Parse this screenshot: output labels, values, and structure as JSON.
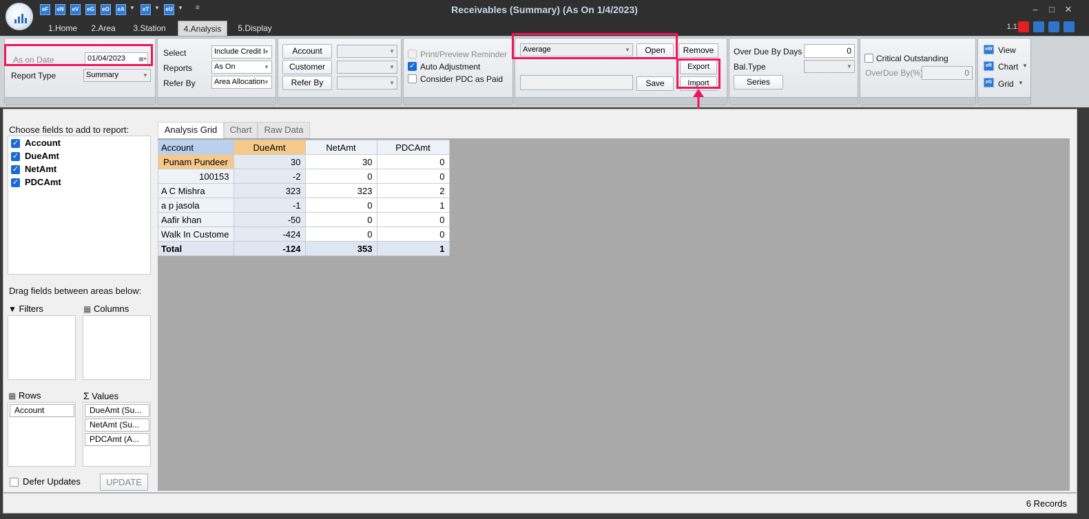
{
  "window": {
    "title": "Receivables (Summary) (As On 1/4/2023)",
    "version": "1.12",
    "quick_access": [
      "eF",
      "eN",
      "eV",
      "eG",
      "eO",
      "eA",
      "eT",
      "eU"
    ],
    "ribbon_tabs": [
      "1.Home",
      "2.Area",
      "3.Station",
      "4.Analysis",
      "5.Display"
    ],
    "active_tab": "4.Analysis"
  },
  "ribbon": {
    "date_group": {
      "as_on_date_label": "As on Date",
      "as_on_date_value": "01/04/2023",
      "report_type_label": "Report Type",
      "report_type_value": "Summary"
    },
    "select_group": {
      "select_label": "Select",
      "select_value": "Include Credit I",
      "reports_label": "Reports",
      "reports_value": "As On",
      "refer_by_label": "Refer By",
      "refer_by_value": "Area Allocation"
    },
    "filter_group": {
      "account_button": "Account",
      "customer_button": "Customer",
      "refer_by_button": "Refer By"
    },
    "options_group": {
      "print_preview_reminder": "Print/Preview Reminder",
      "auto_adjustment": "Auto Adjustment",
      "consider_pdc_as_paid": "Consider PDC as Paid"
    },
    "layout_group": {
      "layout_value": "Average",
      "open_button": "Open",
      "remove_button": "Remove",
      "export_button": "Export",
      "save_button": "Save",
      "import_button": "Import"
    },
    "overdue_group": {
      "over_due_by_days_label": "Over Due By Days",
      "over_due_by_days_value": "0",
      "bal_type_label": "Bal.Type",
      "series_button": "Series"
    },
    "critical_group": {
      "critical_outstanding_label": "Critical Outstanding",
      "overdue_by_pct_label": "OverDue By(%)",
      "overdue_by_pct_value": "0"
    },
    "view_group": {
      "view_label": "View",
      "chart_label": "Chart",
      "grid_label": "Grid"
    }
  },
  "field_list": {
    "title": "Choose fields to add to report:",
    "fields": [
      {
        "label": "Account",
        "checked": true
      },
      {
        "label": "DueAmt",
        "checked": true
      },
      {
        "label": "NetAmt",
        "checked": true
      },
      {
        "label": "PDCAmt",
        "checked": true
      }
    ],
    "drag_title": "Drag fields between areas below:",
    "filters_label": "Filters",
    "columns_label": "Columns",
    "rows_label": "Rows",
    "values_label": "Values",
    "rows_items": [
      "Account"
    ],
    "values_items": [
      "DueAmt (Su...",
      "NetAmt (Su...",
      "PDCAmt (A..."
    ],
    "defer_updates_label": "Defer Updates",
    "update_button": "UPDATE"
  },
  "grid": {
    "tabs": [
      "Analysis Grid",
      "Chart",
      "Raw Data"
    ],
    "active_tab": "Analysis Grid",
    "columns": [
      "Account",
      "DueAmt",
      "NetAmt",
      "PDCAmt"
    ],
    "rows": [
      {
        "account": "Punam Pundeer",
        "due": "30",
        "net": "30",
        "pdc": "0"
      },
      {
        "account": "100153",
        "due": "-2",
        "net": "0",
        "pdc": "0"
      },
      {
        "account": "A C Mishra",
        "due": "323",
        "net": "323",
        "pdc": "2"
      },
      {
        "account": "a p jasola",
        "due": "-1",
        "net": "0",
        "pdc": "1"
      },
      {
        "account": "Aafir khan",
        "due": "-50",
        "net": "0",
        "pdc": "0"
      },
      {
        "account": "Walk In Custome",
        "due": "-424",
        "net": "0",
        "pdc": "0"
      }
    ],
    "total": {
      "account": "Total",
      "due": "-124",
      "net": "353",
      "pdc": "1"
    }
  },
  "status": {
    "records": "6 Records"
  },
  "colors": {
    "highlight": "#f0145a",
    "accent": "#2d79d3",
    "selected_header": "#f6c98b"
  }
}
